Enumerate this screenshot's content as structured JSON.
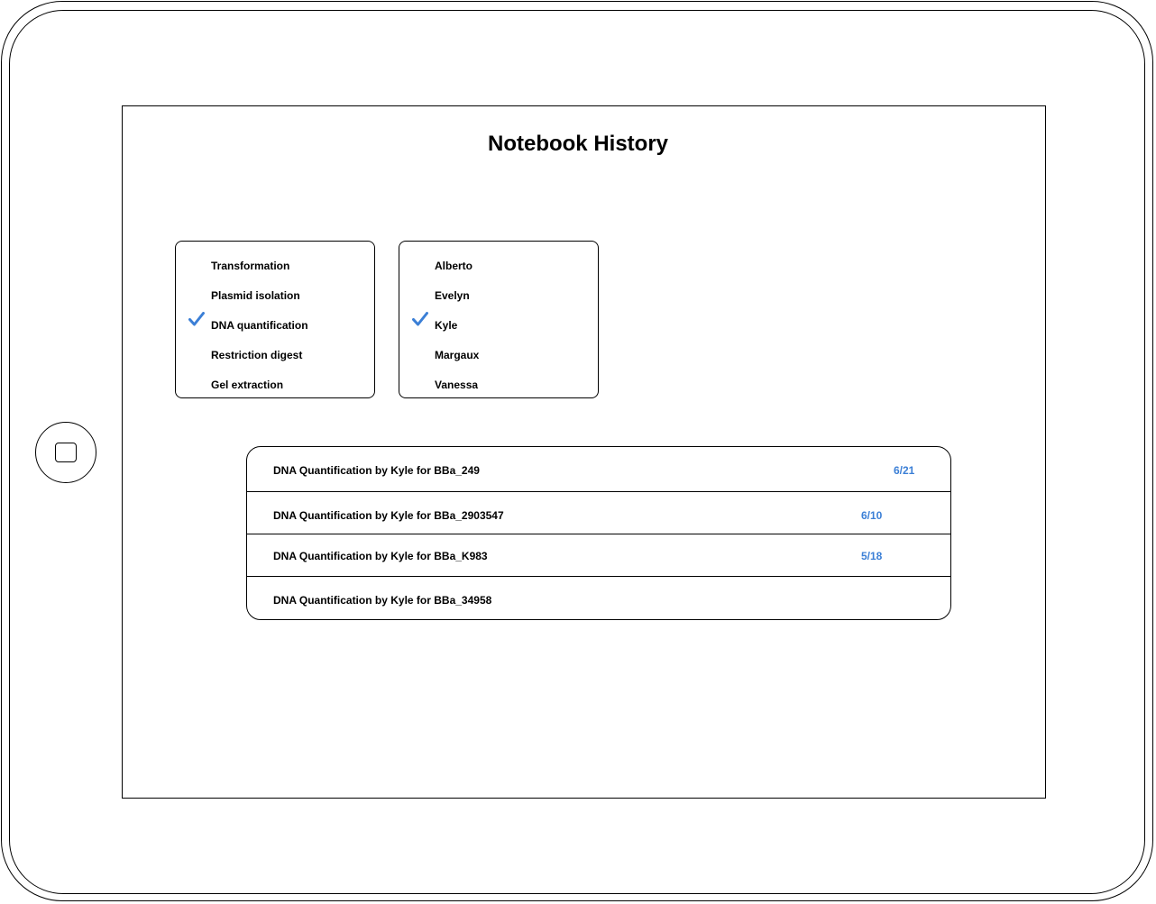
{
  "page_title": "Notebook History",
  "accent_color": "#3b7fd6",
  "protocol_filter": {
    "options": [
      {
        "label": "Transformation",
        "checked": false
      },
      {
        "label": "Plasmid isolation",
        "checked": false
      },
      {
        "label": "DNA quantification",
        "checked": true
      },
      {
        "label": "Restriction digest",
        "checked": false
      },
      {
        "label": "Gel extraction",
        "checked": false
      }
    ]
  },
  "member_filter": {
    "options": [
      {
        "label": "Alberto",
        "checked": false
      },
      {
        "label": "Evelyn",
        "checked": false
      },
      {
        "label": "Kyle",
        "checked": true
      },
      {
        "label": "Margaux",
        "checked": false
      },
      {
        "label": "Vanessa",
        "checked": false
      }
    ]
  },
  "results": [
    {
      "title": "DNA Quantification by Kyle for BBa_249",
      "date": "6/21"
    },
    {
      "title": "DNA Quantification by Kyle for BBa_2903547",
      "date": "6/10"
    },
    {
      "title": "DNA Quantification by Kyle for BBa_K983",
      "date": "5/18"
    },
    {
      "title": "DNA Quantification by Kyle for BBa_34958",
      "date": ""
    }
  ],
  "icons": {
    "check": "checkmark-icon",
    "home": "home-button-icon"
  }
}
